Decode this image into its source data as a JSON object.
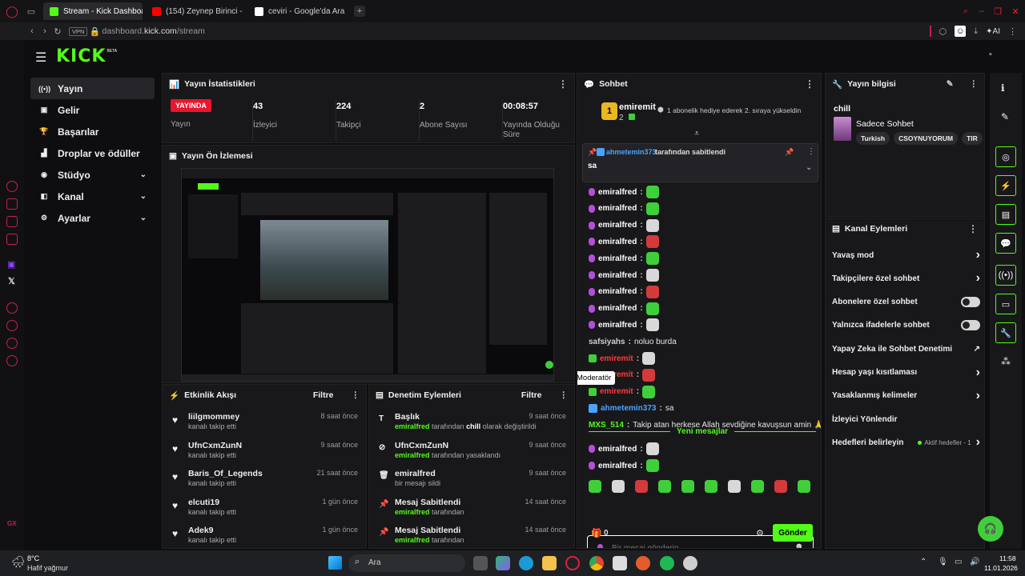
{
  "browser": {
    "tabs": [
      {
        "label": "Stream - Kick Dashboard",
        "active": true,
        "color": "#53fc18"
      },
      {
        "label": "(154) Zeynep Birinci -",
        "active": false,
        "color": "#ff0000"
      },
      {
        "label": "ceviri - Google'da Ara",
        "active": false,
        "color": "#ffffff"
      }
    ],
    "vpn": "VPN",
    "url_host": "dashboard.",
    "url_domain": "kick.com",
    "url_path": "/stream",
    "ai_label": "AI"
  },
  "logo": {
    "text": "KICK",
    "badge": "BETA"
  },
  "nav": [
    {
      "label": "Yayın",
      "icon": "broadcast-icon",
      "glyph": "((•))",
      "active": true,
      "chevron": false
    },
    {
      "label": "Gelir",
      "icon": "income-icon",
      "glyph": "▣",
      "active": false,
      "chevron": false
    },
    {
      "label": "Başarılar",
      "icon": "trophy-icon",
      "glyph": "🏆",
      "active": false,
      "chevron": false
    },
    {
      "label": "Droplar ve ödüller",
      "icon": "drops-icon",
      "glyph": "▟",
      "active": false,
      "chevron": false
    },
    {
      "label": "Stüdyo",
      "icon": "studio-icon",
      "glyph": "◉",
      "active": false,
      "chevron": true
    },
    {
      "label": "Kanal",
      "icon": "channel-icon",
      "glyph": "◧",
      "active": false,
      "chevron": true
    },
    {
      "label": "Ayarlar",
      "icon": "settings-icon",
      "glyph": "⚙",
      "active": false,
      "chevron": true
    }
  ],
  "stats": {
    "title": "Yayın İstatistikleri",
    "items": [
      {
        "value": "YAYINDA",
        "label": "Yayın"
      },
      {
        "value": "43",
        "label": "İzleyici"
      },
      {
        "value": "224",
        "label": "Takipçi"
      },
      {
        "value": "2",
        "label": "Abone Sayısı"
      },
      {
        "value": "00:08:57",
        "label": "Yayında Olduğu Süre"
      }
    ]
  },
  "preview": {
    "title": "Yayın Ön İzlemesi"
  },
  "activity": {
    "title": "Etkinlik Akışı",
    "filter": "Filtre",
    "items": [
      {
        "name": "liilgmommey",
        "sub": "kanalı takip etti",
        "time": "8 saat önce"
      },
      {
        "name": "UfnCxmZunN",
        "sub": "kanalı takip etti",
        "time": "9 saat önce"
      },
      {
        "name": "Baris_Of_Legends",
        "sub": "kanalı takip etti",
        "time": "21 saat önce"
      },
      {
        "name": "elcuti19",
        "sub": "kanalı takip etti",
        "time": "1 gün önce"
      },
      {
        "name": "Adek9",
        "sub": "kanalı takip etti",
        "time": "1 gün önce"
      }
    ]
  },
  "moderation": {
    "title": "Denetim Eylemleri",
    "filter": "Filtre",
    "items": [
      {
        "name": "Başlık",
        "actor": "emiralfred",
        "rest": " tarafından ",
        "bold": "chill",
        "tail": " olarak değiştirildi",
        "time": "9 saat önce",
        "glyph": "T"
      },
      {
        "name": "UfnCxmZunN",
        "actor": "emiralfred",
        "rest": " tarafından yasaklandı",
        "bold": "",
        "tail": "",
        "time": "9 saat önce",
        "glyph": "⊘"
      },
      {
        "name": "emiralfred",
        "actor": "",
        "rest": "bir mesajı sildi",
        "bold": "",
        "tail": "",
        "time": "9 saat önce",
        "glyph": "🗑"
      },
      {
        "name": "Mesaj Sabitlendi",
        "actor": "emiralfred",
        "rest": " tarafından",
        "bold": "",
        "tail": "",
        "time": "14 saat önce",
        "glyph": "📌"
      },
      {
        "name": "Mesaj Sabitlendi",
        "actor": "emiralfred",
        "rest": " tarafından",
        "bold": "",
        "tail": "",
        "time": "14 saat önce",
        "glyph": "📌"
      }
    ]
  },
  "chat": {
    "title": "Sohbet",
    "gifter_name": "emiremit",
    "gifter_count": "2",
    "gift_text": "1 abonelik hediye ederek 2. sıraya yükseldin",
    "pinned_by": "ahmetemin373",
    "pinned_suffix": " tarafından sabitlendi",
    "pinned_msg": "sa",
    "tooltip": "Moderatör",
    "new_messages": "Yeni mesajlar",
    "placeholder": "Bir mesaj gönderin",
    "points": "0",
    "send": "Gönder",
    "lines": [
      {
        "user": "emiralfred",
        "color": "#ffffff",
        "msg": "",
        "emote": "g",
        "badge": "mic"
      },
      {
        "user": "emiralfred",
        "color": "#ffffff",
        "msg": "",
        "emote": "g",
        "badge": "mic"
      },
      {
        "user": "emiralfred",
        "color": "#ffffff",
        "msg": "",
        "emote": "w",
        "badge": "mic"
      },
      {
        "user": "emiralfred",
        "color": "#ffffff",
        "msg": "",
        "emote": "r",
        "badge": "mic"
      },
      {
        "user": "emiralfred",
        "color": "#ffffff",
        "msg": "",
        "emote": "g",
        "badge": "mic"
      },
      {
        "user": "emiralfred",
        "color": "#ffffff",
        "msg": "",
        "emote": "w",
        "badge": "mic"
      },
      {
        "user": "emiralfred",
        "color": "#ffffff",
        "msg": "",
        "emote": "r",
        "badge": "mic"
      },
      {
        "user": "emiralfred",
        "color": "#ffffff",
        "msg": "",
        "emote": "g",
        "badge": "mic"
      },
      {
        "user": "emiralfred",
        "color": "#ffffff",
        "msg": "",
        "emote": "w",
        "badge": "mic"
      },
      {
        "user": "safsiyahs",
        "color": "#cfcfcf",
        "msg": "noluo burda",
        "emote": "",
        "badge": ""
      },
      {
        "user": "emiremit",
        "color": "#ff3b3b",
        "msg": "",
        "emote": "w",
        "badge": "gift"
      },
      {
        "user": "emiremit",
        "color": "#ff3b3b",
        "msg": "",
        "emote": "r",
        "badge": "gift"
      },
      {
        "user": "emiremit",
        "color": "#ff3b3b",
        "msg": "",
        "emote": "g",
        "badge": "gift"
      },
      {
        "user": "ahmetemin373",
        "color": "#4aa3ff",
        "msg": "sa",
        "emote": "",
        "badge": "mod"
      },
      {
        "user": "MXS_514",
        "color": "#53fc18",
        "msg": "Takip atan herkese Allah sevdiğine kavuşsun amin 🙏🤍",
        "emote": "",
        "badge": ""
      }
    ],
    "new_lines": [
      {
        "user": "emiralfred",
        "color": "#ffffff",
        "emote": "w"
      },
      {
        "user": "emiralfred",
        "color": "#ffffff",
        "emote": "g"
      }
    ],
    "emote_bar": [
      "g",
      "w",
      "r",
      "g",
      "g",
      "g",
      "w",
      "g",
      "r",
      "g"
    ]
  },
  "stream_info": {
    "title": "Yayın bilgisi",
    "stream_title": "chill",
    "category": "Sadece Sohbet",
    "tags": [
      "Turkish",
      "CSOYNUYORUM",
      "TIR"
    ]
  },
  "channel_actions": {
    "title": "Kanal Eylemleri",
    "items": [
      {
        "label": "Yavaş mod",
        "kind": "chevron",
        "extra": ""
      },
      {
        "label": "Takipçilere özel sohbet",
        "kind": "chevron",
        "extra": ""
      },
      {
        "label": "Abonelere özel sohbet",
        "kind": "toggle",
        "extra": ""
      },
      {
        "label": "Yalnızca ifadelerle sohbet",
        "kind": "toggle",
        "extra": ""
      },
      {
        "label": "Yapay Zeka ile Sohbet Denetimi",
        "kind": "external",
        "extra": ""
      },
      {
        "label": "Hesap yaşı kısıtlaması",
        "kind": "chevron",
        "extra": ""
      },
      {
        "label": "Yasaklanmış kelimeler",
        "kind": "chevron",
        "extra": ""
      },
      {
        "label": "İzleyici Yönlendir",
        "kind": "none",
        "extra": ""
      },
      {
        "label": "Hedefleri belirleyin",
        "kind": "chevron",
        "extra": "Aktif hedefler - 1"
      }
    ]
  },
  "taskbar": {
    "weather_temp": "8°C",
    "weather_desc": "Hafif yağmur",
    "search": "Ara",
    "time": "11:58",
    "date": "11.01.2026"
  }
}
